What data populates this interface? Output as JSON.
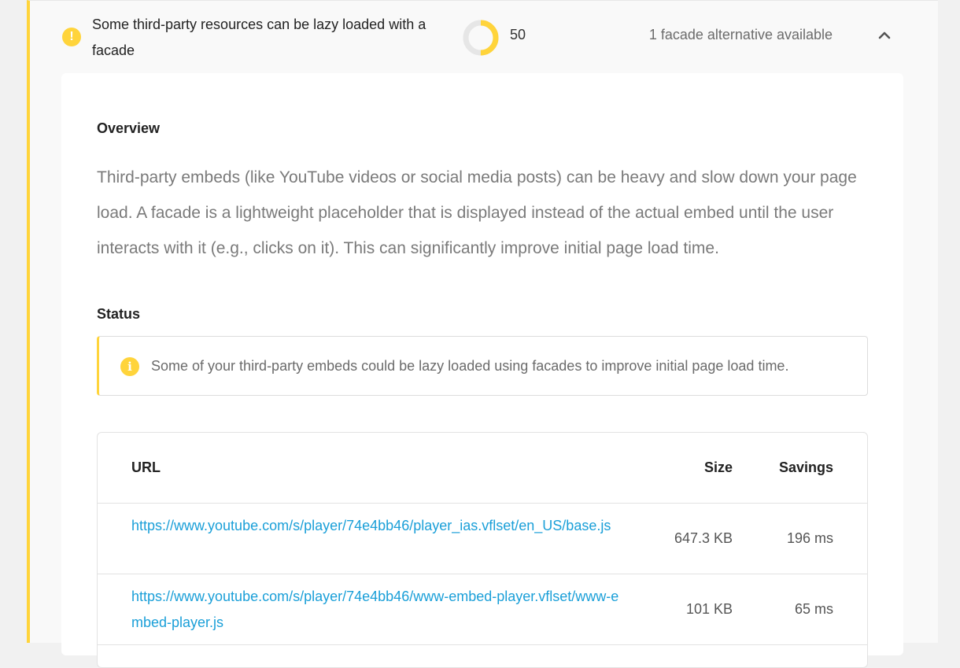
{
  "audit": {
    "title": "Some third-party resources can be lazy loaded with a facade",
    "score": "50",
    "score_fraction": 0.5,
    "summary": "1 facade alternative available",
    "warn_glyph": "!",
    "status_color": "#ffd43b"
  },
  "overview": {
    "heading": "Overview",
    "text": "Third-party embeds (like YouTube videos or social media posts) can be heavy and slow down your page load. A facade is a lightweight placeholder that is displayed instead of the actual embed until the user interacts with it (e.g., clicks on it). This can significantly improve initial page load time."
  },
  "status": {
    "heading": "Status",
    "info_glyph": "i",
    "message": "Some of your third-party embeds could be lazy loaded using facades to improve initial page load time."
  },
  "table": {
    "headers": {
      "url": "URL",
      "size": "Size",
      "savings": "Savings"
    },
    "rows": [
      {
        "url": "https://www.youtube.com/s/player/74e4bb46/player_ias.vflset/en_US/base.js",
        "size": "647.3 KB",
        "savings": "196 ms"
      },
      {
        "url": "https://www.youtube.com/s/player/74e4bb46/www-embed-player.vflset/www-embed-player.js",
        "size": "101 KB",
        "savings": "65 ms"
      }
    ]
  },
  "icons": {
    "warning": "warning-icon",
    "info": "info-icon",
    "chevron": "chevron-up-icon"
  }
}
